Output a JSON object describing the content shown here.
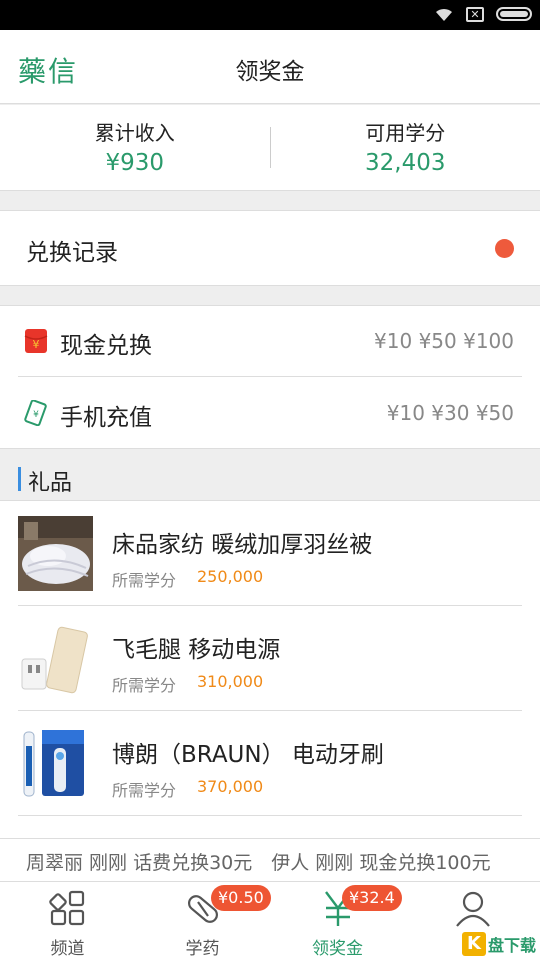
{
  "header": {
    "logo": "藥信",
    "title": "领奖金"
  },
  "stats": {
    "income_label": "累计收入",
    "income_value": "¥930",
    "credits_label": "可用学分",
    "credits_value": "32,403"
  },
  "history": {
    "label": "兑换记录"
  },
  "exchange": [
    {
      "label": "现金兑换",
      "values": "¥10 ¥50 ¥100",
      "icon": "red-envelope-icon"
    },
    {
      "label": "手机充值",
      "values": "¥10 ¥30 ¥50",
      "icon": "phone-card-icon"
    }
  ],
  "gift_section": {
    "title": "礼品"
  },
  "gifts": [
    {
      "name": "床品家纺 暖绒加厚羽丝被",
      "price_label": "所需学分",
      "price": "250,000"
    },
    {
      "name": "飞毛腿 移动电源",
      "price_label": "所需学分",
      "price": "310,000"
    },
    {
      "name": "博朗（BRAUN） 电动牙刷",
      "price_label": "所需学分",
      "price": "370,000"
    }
  ],
  "ticker": {
    "text": "周翠丽 刚刚 话费兑换30元　伊人 刚刚 现金兑换100元"
  },
  "tabs": [
    {
      "label": "频道",
      "icon": "grid-icon"
    },
    {
      "label": "学药",
      "icon": "pill-icon",
      "badge": "¥0.50"
    },
    {
      "label": "领奖金",
      "icon": "yen-icon",
      "badge": "¥32.4",
      "active": true
    },
    {
      "label": "",
      "icon": "person-icon"
    }
  ],
  "watermark": {
    "k": "K",
    "text": "盘下载"
  },
  "colors": {
    "accent": "#2a9a6b",
    "price": "#f08a18",
    "badge": "#ee5533",
    "dot": "#ee5a3c"
  }
}
